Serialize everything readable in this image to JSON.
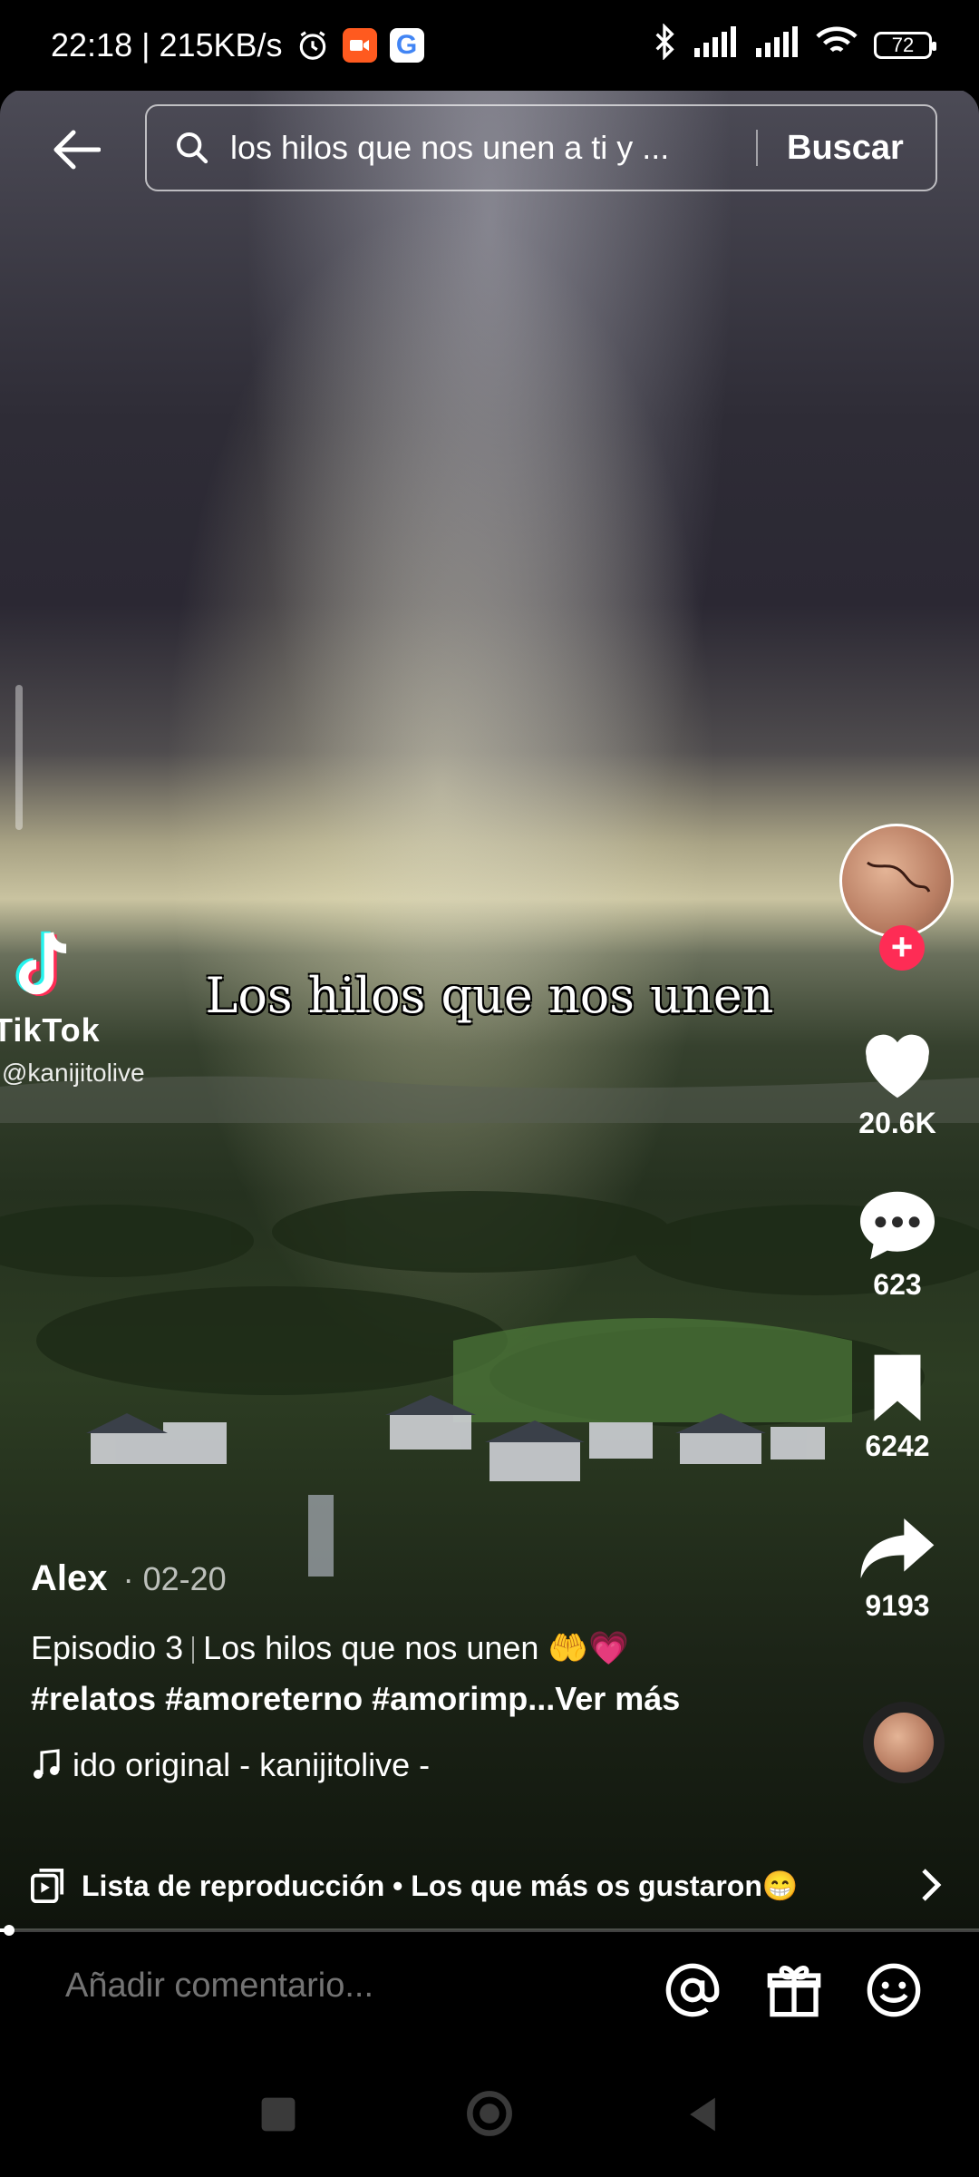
{
  "status_bar": {
    "time_speed": "22:18 | 215KB/s",
    "battery": "72"
  },
  "search": {
    "query": "los hilos que nos unen a ti y ...",
    "button": "Buscar"
  },
  "watermark": {
    "brand": "TikTok",
    "handle": "@kanijitolive"
  },
  "video_caption": "Los hilos que nos unen",
  "actions": {
    "likes": "20.6K",
    "comments": "623",
    "saves": "6242",
    "shares": "9193"
  },
  "post": {
    "author": "Alex",
    "date": "· 02-20",
    "episode": "Episodio 3",
    "title": "Los hilos que nos unen 🤲💗",
    "hashtags": "#relatos #amoreterno #amorimp...",
    "more": "Ver más",
    "sound": "ido original - kanijitolive -"
  },
  "playlist": {
    "label": "Lista de reproducción • Los que más os gustaron😁"
  },
  "comment_bar": {
    "placeholder": "Añadir comentario..."
  },
  "icons": [
    "back-arrow-icon",
    "search-icon",
    "alarm-icon",
    "bluetooth-icon",
    "signal-icon",
    "wifi-icon",
    "heart-icon",
    "comment-icon",
    "bookmark-icon",
    "share-icon",
    "music-note-icon",
    "playlist-icon",
    "chevron-right-icon",
    "at-icon",
    "gift-icon",
    "emoji-icon",
    "tiktok-logo-icon"
  ]
}
